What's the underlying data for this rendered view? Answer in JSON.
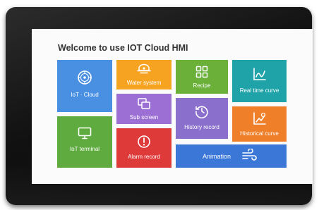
{
  "screen": {
    "title": "Welcome to use IOT Cloud HMI"
  },
  "tiles": {
    "iot_cloud": {
      "label": "IoT · Cloud",
      "color": "#4a90e2"
    },
    "iot_terminal": {
      "label": "IoT terminal",
      "color": "#5fab3f"
    },
    "water_system": {
      "label": "Water system",
      "color": "#f6a322"
    },
    "sub_screen": {
      "label": "Sub screen",
      "color": "#9b6fd4"
    },
    "alarm_record": {
      "label": "Alarm record",
      "color": "#df3a3a"
    },
    "recipe": {
      "label": "Recipe",
      "color": "#6bb039"
    },
    "history_record": {
      "label": "History record",
      "color": "#8a6fcc"
    },
    "real_time_curve": {
      "label": "Real time curve",
      "color": "#1fa3a8"
    },
    "historical_curve": {
      "label": "Historical curve",
      "color": "#f07f2a"
    },
    "animation": {
      "label": "Animation",
      "color": "#3b77d6"
    }
  },
  "icons": {
    "iot_cloud": "iot-badge-icon",
    "iot_terminal": "monitor-icon",
    "water_system": "pump-icon",
    "sub_screen": "stacked-windows-icon",
    "alarm_record": "alert-circle-icon",
    "recipe": "grid-icon",
    "history_record": "history-clock-icon",
    "real_time_curve": "line-chart-icon",
    "historical_curve": "curve-chart-icon",
    "animation": "wind-icon"
  }
}
